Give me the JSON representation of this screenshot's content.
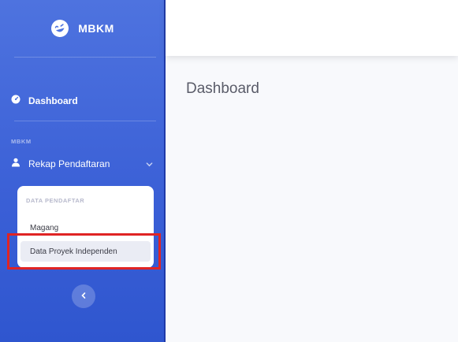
{
  "brand": {
    "name": "MBKM",
    "icon": "laugh-wink-icon"
  },
  "sidebar": {
    "dashboard_label": "Dashboard",
    "section_heading": "MBKM",
    "rekap_label": "Rekap Pendaftaran",
    "submenu": {
      "heading": "DATA PENDAFTAR",
      "items": [
        {
          "label": "Magang",
          "active": false
        },
        {
          "label": "Data Proyek Independen",
          "active": true
        }
      ]
    }
  },
  "main": {
    "page_title": "Dashboard"
  },
  "colors": {
    "sidebar_primary": "#4e73df",
    "highlight": "#e02424",
    "title_text": "#5a5c69"
  }
}
